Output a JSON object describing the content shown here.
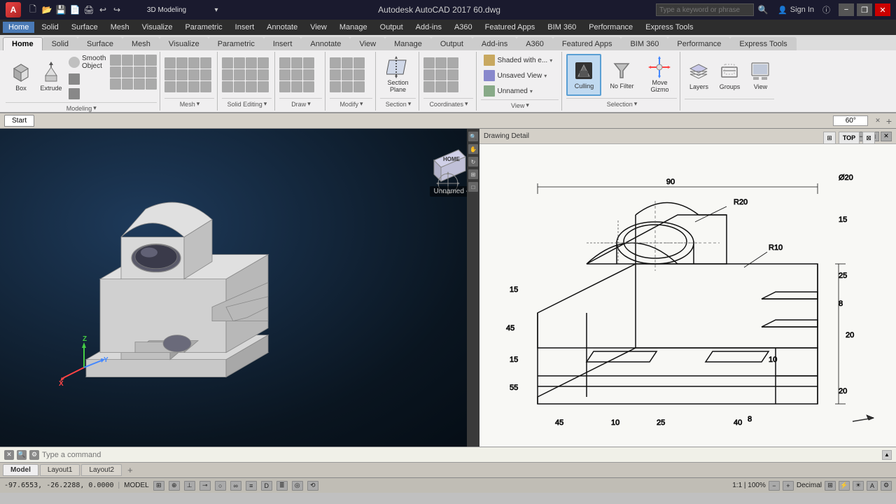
{
  "titlebar": {
    "app_name": "A",
    "workspace": "3D Modeling",
    "title": "Autodesk AutoCAD 2017  60.dwg",
    "search_placeholder": "Type a keyword or phrase",
    "user": "Sign In",
    "minimize": "−",
    "restore": "❐",
    "close": "✕"
  },
  "menubar": {
    "items": [
      "Home",
      "Solid",
      "Surface",
      "Mesh",
      "Visualize",
      "Parametric",
      "Insert",
      "Annotate",
      "View",
      "Manage",
      "Output",
      "Add-ins",
      "A360",
      "Featured Apps",
      "BIM 360",
      "Performance",
      "Express Tools"
    ]
  },
  "ribbon": {
    "tabs": [
      "Home",
      "Solid",
      "Surface",
      "Mesh",
      "Visualize",
      "Parametric",
      "Insert",
      "Annotate",
      "View",
      "Manage",
      "Output",
      "Add-ins",
      "A360",
      "Featured Apps",
      "BIM 360",
      "Performance",
      "Express Tools"
    ],
    "active_tab": "Home",
    "groups": [
      {
        "label": "Modeling",
        "buttons": [
          {
            "id": "box",
            "label": "Box",
            "icon": "📦"
          },
          {
            "id": "extrude",
            "label": "Extrude",
            "icon": "⬆"
          },
          {
            "id": "smooth-object",
            "label": "Smooth\nObject",
            "icon": "◉"
          }
        ]
      },
      {
        "label": "Mesh",
        "buttons": []
      },
      {
        "label": "Solid Editing",
        "buttons": []
      },
      {
        "label": "Draw",
        "buttons": []
      },
      {
        "label": "Modify",
        "buttons": []
      },
      {
        "label": "Section",
        "buttons": [
          {
            "id": "section-plane",
            "label": "Section\nPlane",
            "icon": "◧"
          }
        ]
      },
      {
        "label": "Coordinates",
        "buttons": []
      },
      {
        "label": "View",
        "buttons": [
          {
            "id": "shaded-view",
            "label": "Shaded with e...",
            "icon": ""
          },
          {
            "id": "unsaved-view",
            "label": "Unsaved View",
            "icon": ""
          },
          {
            "id": "unnamed",
            "label": "Unnamed",
            "icon": ""
          }
        ]
      },
      {
        "label": "Selection",
        "buttons": [
          {
            "id": "culling",
            "label": "Culling",
            "icon": "⬛"
          },
          {
            "id": "no-filter",
            "label": "No Filter",
            "icon": "▽"
          },
          {
            "id": "move-gizmo",
            "label": "Move\nGizmo",
            "icon": "⊕"
          }
        ]
      },
      {
        "label": "",
        "buttons": [
          {
            "id": "layers",
            "label": "Layers",
            "icon": "▤"
          },
          {
            "id": "groups",
            "label": "Groups",
            "icon": "▣"
          },
          {
            "id": "view",
            "label": "View",
            "icon": "👁"
          }
        ]
      }
    ],
    "sub_toolbar": {
      "modeling_label": "Modeling",
      "mesh_label": "Mesh",
      "solid_editing_label": "Solid Editing",
      "draw_label": "Draw",
      "modify_label": "Modify",
      "section_label": "Section",
      "coordinates_label": "Coordinates",
      "view_label": "View",
      "selection_label": "Selection"
    }
  },
  "workspace_tabs": {
    "start_tab": "Start",
    "angle_value": "60°",
    "add_tab": "+"
  },
  "viewport3d": {
    "view_label": "Unnamed -"
  },
  "drawing_viewport": {
    "title": "Drawing Detail",
    "view_label": "TOP"
  },
  "command_line": {
    "placeholder": "Type a command"
  },
  "status_bar": {
    "coords": "-97.6553, -26.2288, 0.0000",
    "model_label": "MODEL",
    "scale": "1:1 | 100%",
    "units": "Decimal"
  },
  "layout_tabs": {
    "model": "Model",
    "layout1": "Layout1",
    "layout2": "Layout2",
    "add": "+"
  }
}
